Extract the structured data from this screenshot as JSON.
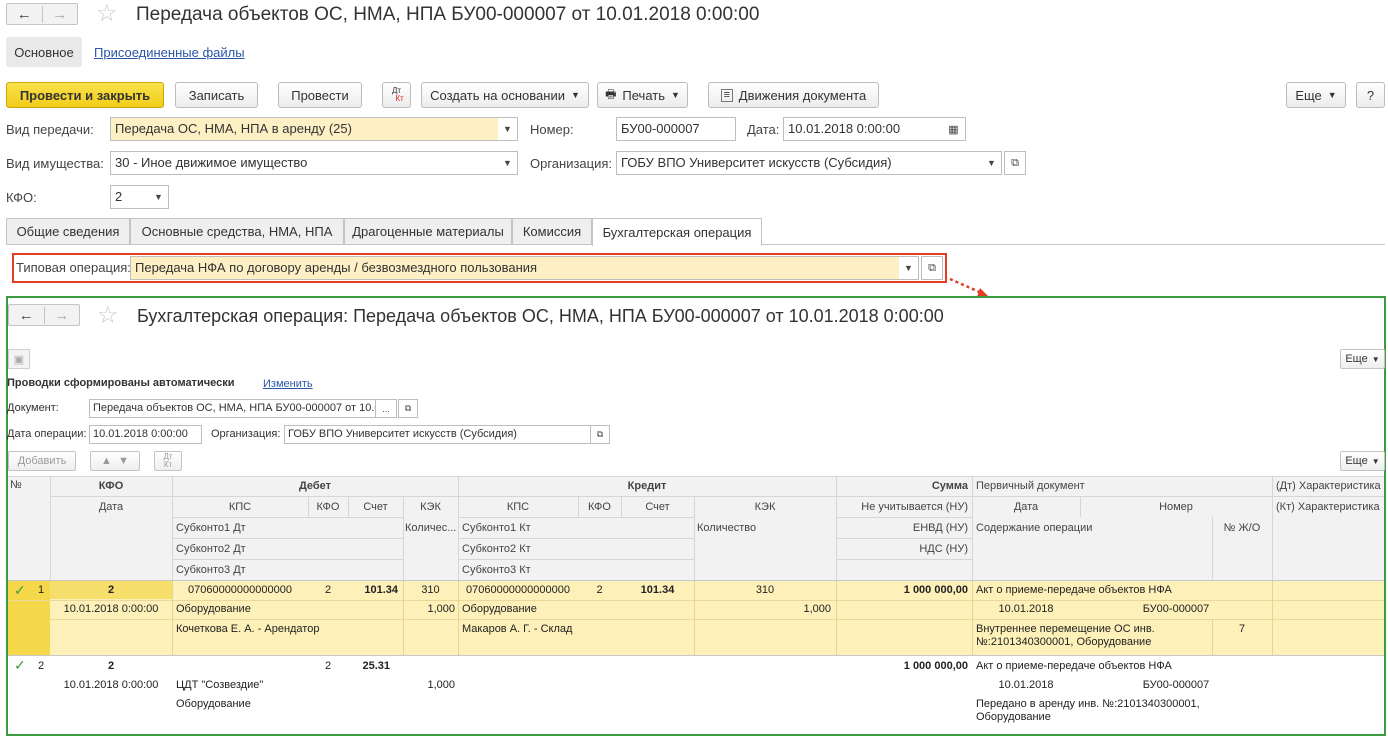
{
  "header": {
    "title": "Передача объектов ОС, НМА, НПА БУ00-000007 от 10.01.2018 0:00:00",
    "back_icon": "←",
    "forward_icon": "→",
    "star_icon": "☆"
  },
  "top_tabs": {
    "main": "Основное",
    "files": "Присоединенные файлы"
  },
  "toolbar": {
    "post_close": "Провести и закрыть",
    "save": "Записать",
    "post": "Провести",
    "dtkt_dt": "Дт",
    "dtkt_kt": "Кт",
    "create_based": "Создать на основании",
    "print": "Печать",
    "movements": "Движения документа",
    "more": "Еще",
    "help": "?"
  },
  "form": {
    "transfer_type_label": "Вид передачи:",
    "transfer_type_value": "Передача ОС, НМА, НПА в аренду (25)",
    "number_label": "Номер:",
    "number_value": "БУ00-000007",
    "date_label": "Дата:",
    "date_value": "10.01.2018  0:00:00",
    "property_type_label": "Вид имущества:",
    "property_type_value": "30 - Иное движимое имущество",
    "org_label": "Организация:",
    "org_value": "ГОБУ ВПО Университет искусств (Субсидия)",
    "kfo_label": "КФО:",
    "kfo_value": "2"
  },
  "tabs": [
    "Общие сведения",
    "Основные средства, НМА, НПА",
    "Драгоценные материалы",
    "Комиссия",
    "Бухгалтерская операция"
  ],
  "typical_op": {
    "label": "Типовая операция:",
    "value": "Передача НФА по договору аренды / безвозмездного пользования"
  },
  "colors": {
    "highlight": "#e53c25",
    "green": "#3d9b3d",
    "yellow_row": "#fdf0b8",
    "selected_row": "#f9e07a"
  },
  "sub": {
    "title": "Бухгалтерская операция: Передача объектов ОС, НМА, НПА БУ00-000007 от 10.01.2018 0:00:00",
    "more": "Еще",
    "auto_text": "Проводки сформированы автоматически",
    "change_link": "Изменить",
    "doc_label": "Документ:",
    "doc_value": "Передача объектов ОС, НМА, НПА БУ00-000007 от 10.0",
    "doc_more": "...",
    "op_date_label": "Дата операции:",
    "op_date_value": "10.01.2018  0:00:00",
    "org_label": "Организация:",
    "org_value": "ГОБУ ВПО Университет искусств (Субсидия)",
    "add": "Добавить",
    "more2": "Еще"
  },
  "table": {
    "h": {
      "num": "№",
      "kfo": "КФО",
      "date": "Дата",
      "debit": "Дебет",
      "credit": "Кредит",
      "sum": "Сумма",
      "primary_doc": "Первичный документ",
      "dt_char": "(Дт) Характеристика",
      "kt_char": "(Кт) Характеристика",
      "kps": "КПС",
      "kfo2": "КФО",
      "account": "Счет",
      "kek": "КЭК",
      "kps_c": "КПС",
      "kfo_c": "КФО",
      "account_c": "Счет",
      "kek_c": "КЭК",
      "not_counted": "Не учитывается (НУ)",
      "pd_date": "Дата",
      "pd_number": "Номер",
      "sub1_dt": "Субконто1 Дт",
      "sub2_dt": "Субконто2 Дт",
      "sub3_dt": "Субконто3 Дт",
      "qty_dt": "Количес...",
      "sub1_kt": "Субконто1 Кт",
      "sub2_kt": "Субконто2 Кт",
      "sub3_kt": "Субконто3 Кт",
      "qty_kt": "Количество",
      "envd": "ЕНВД (НУ)",
      "nds": "НДС (НУ)",
      "content": "Содержание операции",
      "journal": "№ Ж/О"
    },
    "rows": [
      {
        "check": "✓",
        "num": "1",
        "kfo": "2",
        "date": "10.01.2018 0:00:00",
        "dt_kps": "07060000000000000",
        "dt_kfo": "2",
        "dt_account": "101.34",
        "dt_kek": "310",
        "dt_sub1": "Оборудование",
        "dt_qty": "1,000",
        "dt_sub2": "Кочеткова Е. А. - Арендатор",
        "kt_kps": "07060000000000000",
        "kt_kfo": "2",
        "kt_account": "101.34",
        "kt_kek": "310",
        "kt_sub1": "Оборудование",
        "kt_qty": "1,000",
        "kt_sub2": "Макаров А. Г. - Склад",
        "sum": "1 000 000,00",
        "pd_name": "Акт о приеме-передаче объектов НФА",
        "pd_date": "10.01.2018",
        "pd_number": "БУ00-000007",
        "content_1": "Внутреннее перемещение ОС инв.",
        "content_2": "№:2101340300001, Оборудование",
        "journal": "7"
      },
      {
        "check": "✓",
        "num": "2",
        "kfo": "2",
        "date": "10.01.2018 0:00:00",
        "dt_kfo": "2",
        "dt_account": "25.31",
        "dt_sub1": "ЦДТ \"Созвездие\"",
        "dt_qty": "1,000",
        "dt_sub2": "Оборудование",
        "sum": "1 000 000,00",
        "pd_name": "Акт о приеме-передаче объектов НФА",
        "pd_date": "10.01.2018",
        "pd_number": "БУ00-000007",
        "content_1": "Передано в аренду инв. №:2101340300001,",
        "content_2": "Оборудование"
      }
    ]
  }
}
